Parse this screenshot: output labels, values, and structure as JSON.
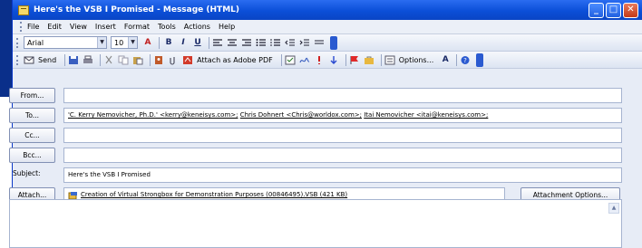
{
  "window": {
    "title": "Here's the VSB I Promised - Message (HTML)",
    "controls": [
      "minimize",
      "maximize",
      "close"
    ]
  },
  "menu": [
    "File",
    "Edit",
    "View",
    "Insert",
    "Format",
    "Tools",
    "Actions",
    "Help"
  ],
  "format_toolbar": {
    "font": "Arial",
    "size": "10",
    "buttons": [
      "A",
      "B",
      "I",
      "U"
    ]
  },
  "standard_toolbar": {
    "send": "Send",
    "attach_pdf": "Attach as Adobe PDF",
    "options": "Options...",
    "superscript": "A"
  },
  "fields": {
    "from_label": "From...",
    "from_value": "",
    "to_label": "To...",
    "to_recipients": [
      "'C. Kerry Nemovicher, Ph.D.' <kerry@keneisys.com>;",
      "Chris Dohnert <Chris@worldox.com>;",
      "Itai Nemovicher <itai@keneisys.com>;"
    ],
    "cc_label": "Cc...",
    "cc_value": "",
    "bcc_label": "Bcc...",
    "bcc_value": "",
    "subject_label": "Subject:",
    "subject_value": "Here's the VSB I Promised",
    "attach_label": "Attach...",
    "attachment": "Creation of Virtual Strongbox for Demonstration  Purposes (00846495).VSB (421 KB)",
    "attachment_options": "Attachment Options..."
  },
  "colors": {
    "titlebar": "#0b4fd8",
    "window_bg": "#e7ecf6"
  }
}
